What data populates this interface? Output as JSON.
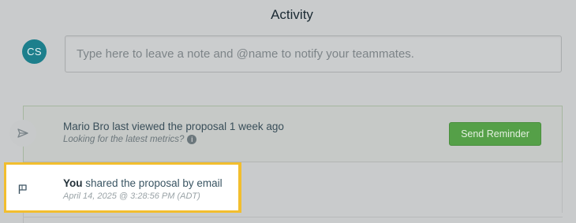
{
  "activity": {
    "title": "Activity"
  },
  "composer": {
    "avatar_initials": "CS",
    "placeholder": "Type here to leave a note and @name to notify your teammates.",
    "avatar_color": "#1d7f8c"
  },
  "events": {
    "view": {
      "icon": "send-icon",
      "message": "Mario Bro last viewed the proposal 1 week ago",
      "hint": "Looking for the latest metrics?",
      "info_glyph": "i",
      "button_label": "Send Reminder",
      "button_color": "#55a048"
    },
    "shared": {
      "icon": "flag-icon",
      "actor": "You",
      "action": "shared the proposal by email",
      "timestamp": "April 14, 2025 @ 3:28:56 PM (ADT)",
      "highlight_color": "#f2be2e"
    }
  }
}
